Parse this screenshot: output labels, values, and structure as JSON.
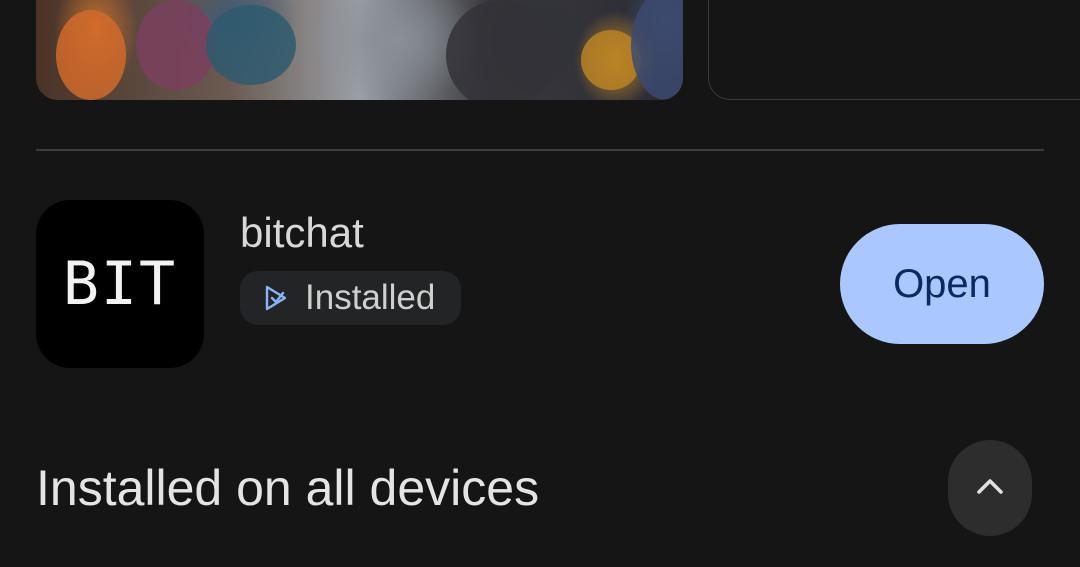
{
  "media": {
    "screenshot_alt": "people using phones photo"
  },
  "app": {
    "icon_text": "BIT",
    "name": "bitchat",
    "status_label": "Installed",
    "status_icon": "play-store-icon",
    "open_label": "Open"
  },
  "section": {
    "title": "Installed on all devices",
    "toggle_icon": "chevron-up-icon"
  },
  "colors": {
    "background": "#151515",
    "open_button_bg": "#aac7ff",
    "open_button_text": "#0a2a60",
    "chip_bg": "#232425",
    "accent_icon": "#8ab4f8"
  }
}
